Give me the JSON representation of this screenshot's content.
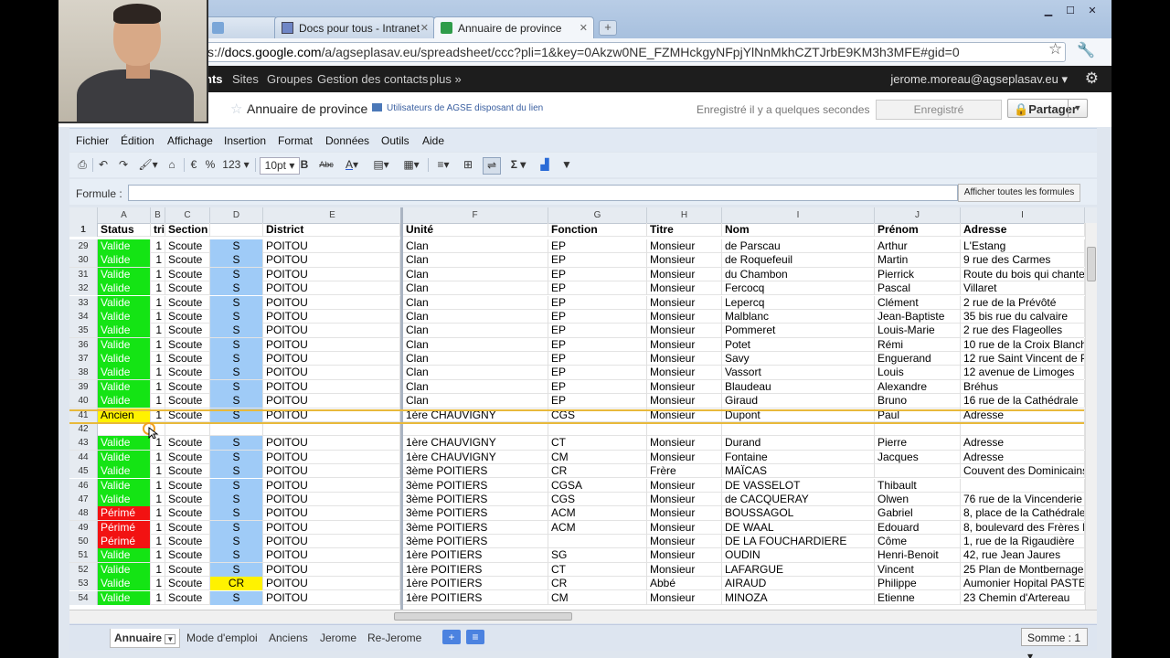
{
  "browser": {
    "tabs": [
      {
        "label": "",
        "active": false
      },
      {
        "label": "Docs pour tous - Intranet",
        "active": false
      },
      {
        "label": "Annuaire de province",
        "active": true
      }
    ],
    "url_prefix": "s://",
    "url_domain": "docs.google.com",
    "url_rest": "/a/agseplasav.eu/spreadsheet/ccc?pli=1&key=0Akzw0NE_FZMHckgyNFpjYlNnMkhCZTJrbE9KM3h3MFE#gid=0"
  },
  "gbar": {
    "links": [
      "nts",
      "Sites",
      "Groupes",
      "Gestion des contacts",
      "plus »"
    ],
    "user": "jerome.moreau@agseplasav.eu ▾"
  },
  "doc": {
    "brand": "nts",
    "title": "Annuaire de province",
    "share_info": "Utilisateurs de AGSE disposant du lien",
    "saved_status": "Enregistré il y a quelques secondes",
    "save_button": "Enregistré",
    "share_button": "Partager"
  },
  "menus": [
    "Fichier",
    "Édition",
    "Affichage",
    "Insertion",
    "Format",
    "Données",
    "Outils",
    "Aide"
  ],
  "toolbar": {
    "euro": "€",
    "percent": "%",
    "numfmt": "123 ▾",
    "fontsize": "10pt ▾",
    "bold": "B",
    "strike": "Abc",
    "sigma": "Σ ▾"
  },
  "formula": {
    "label": "Formule :",
    "value": "",
    "show_all": "Afficher toutes les formules"
  },
  "columns": [
    "A",
    "B",
    "C",
    "D",
    "E",
    "F",
    "G",
    "H",
    "I",
    "J",
    "I"
  ],
  "header_row": {
    "n": "1",
    "cells": [
      "Status",
      "tri",
      "Section",
      "",
      "District",
      "Unité",
      "Fonction",
      "Titre",
      "Nom",
      "Prénom",
      "Adresse"
    ]
  },
  "rows": [
    {
      "n": "29",
      "s": "Valide",
      "sc": "g",
      "t": "1",
      "sec": "Scoute",
      "d": "S",
      "dc": "b",
      "dist": "POITOU",
      "u": "Clan",
      "f": "EP",
      "ti": "Monsieur",
      "nom": "de Parscau",
      "pre": "Arthur",
      "adr": "L'Estang"
    },
    {
      "n": "30",
      "s": "Valide",
      "sc": "g",
      "t": "1",
      "sec": "Scoute",
      "d": "S",
      "dc": "b",
      "dist": "POITOU",
      "u": "Clan",
      "f": "EP",
      "ti": "Monsieur",
      "nom": "de Roquefeuil",
      "pre": "Martin",
      "adr": "9 rue des Carmes"
    },
    {
      "n": "31",
      "s": "Valide",
      "sc": "g",
      "t": "1",
      "sec": "Scoute",
      "d": "S",
      "dc": "b",
      "dist": "POITOU",
      "u": "Clan",
      "f": "EP",
      "ti": "Monsieur",
      "nom": "du Chambon",
      "pre": "Pierrick",
      "adr": "Route du bois qui chante"
    },
    {
      "n": "32",
      "s": "Valide",
      "sc": "g",
      "t": "1",
      "sec": "Scoute",
      "d": "S",
      "dc": "b",
      "dist": "POITOU",
      "u": "Clan",
      "f": "EP",
      "ti": "Monsieur",
      "nom": "Fercocq",
      "pre": "Pascal",
      "adr": "Villaret"
    },
    {
      "n": "33",
      "s": "Valide",
      "sc": "g",
      "t": "1",
      "sec": "Scoute",
      "d": "S",
      "dc": "b",
      "dist": "POITOU",
      "u": "Clan",
      "f": "EP",
      "ti": "Monsieur",
      "nom": "Lepercq",
      "pre": "Clément",
      "adr": "2 rue de la Prévôté"
    },
    {
      "n": "34",
      "s": "Valide",
      "sc": "g",
      "t": "1",
      "sec": "Scoute",
      "d": "S",
      "dc": "b",
      "dist": "POITOU",
      "u": "Clan",
      "f": "EP",
      "ti": "Monsieur",
      "nom": "Malblanc",
      "pre": "Jean-Baptiste",
      "adr": "35 bis rue du calvaire"
    },
    {
      "n": "35",
      "s": "Valide",
      "sc": "g",
      "t": "1",
      "sec": "Scoute",
      "d": "S",
      "dc": "b",
      "dist": "POITOU",
      "u": "Clan",
      "f": "EP",
      "ti": "Monsieur",
      "nom": "Pommeret",
      "pre": "Louis-Marie",
      "adr": "2 rue des Flageolles"
    },
    {
      "n": "36",
      "s": "Valide",
      "sc": "g",
      "t": "1",
      "sec": "Scoute",
      "d": "S",
      "dc": "b",
      "dist": "POITOU",
      "u": "Clan",
      "f": "EP",
      "ti": "Monsieur",
      "nom": "Potet",
      "pre": "Rémi",
      "adr": "10 rue de la Croix Blanch"
    },
    {
      "n": "37",
      "s": "Valide",
      "sc": "g",
      "t": "1",
      "sec": "Scoute",
      "d": "S",
      "dc": "b",
      "dist": "POITOU",
      "u": "Clan",
      "f": "EP",
      "ti": "Monsieur",
      "nom": "Savy",
      "pre": "Enguerand",
      "adr": "12 rue Saint Vincent de P"
    },
    {
      "n": "38",
      "s": "Valide",
      "sc": "g",
      "t": "1",
      "sec": "Scoute",
      "d": "S",
      "dc": "b",
      "dist": "POITOU",
      "u": "Clan",
      "f": "EP",
      "ti": "Monsieur",
      "nom": "Vassort",
      "pre": "Louis",
      "adr": "12 avenue de Limoges"
    },
    {
      "n": "39",
      "s": "Valide",
      "sc": "g",
      "t": "1",
      "sec": "Scoute",
      "d": "S",
      "dc": "b",
      "dist": "POITOU",
      "u": "Clan",
      "f": "EP",
      "ti": "Monsieur",
      "nom": "Blaudeau",
      "pre": "Alexandre",
      "adr": "Bréhus"
    },
    {
      "n": "40",
      "s": "Valide",
      "sc": "g",
      "t": "1",
      "sec": "Scoute",
      "d": "S",
      "dc": "b",
      "dist": "POITOU",
      "u": "Clan",
      "f": "EP",
      "ti": "Monsieur",
      "nom": "Giraud",
      "pre": "Bruno",
      "adr": "16 rue de la Cathédrale"
    },
    {
      "n": "41",
      "s": "Ancien",
      "sc": "y",
      "t": "1",
      "sec": "Scoute",
      "d": "S",
      "dc": "b",
      "dist": "POITOU",
      "u": "1ère CHAUVIGNY",
      "f": "CGS",
      "ti": "Monsieur",
      "nom": "Dupont",
      "pre": "Paul",
      "adr": "Adresse"
    },
    {
      "n": "42",
      "s": "",
      "sc": "",
      "t": "",
      "sec": "",
      "d": "",
      "dc": "",
      "dist": "",
      "u": "",
      "f": "",
      "ti": "",
      "nom": "",
      "pre": "",
      "adr": ""
    },
    {
      "n": "43",
      "s": "Valide",
      "sc": "g",
      "t": "1",
      "sec": "Scoute",
      "d": "S",
      "dc": "b",
      "dist": "POITOU",
      "u": "1ère CHAUVIGNY",
      "f": "CT",
      "ti": "Monsieur",
      "nom": "Durand",
      "pre": "Pierre",
      "adr": "Adresse"
    },
    {
      "n": "44",
      "s": "Valide",
      "sc": "g",
      "t": "1",
      "sec": "Scoute",
      "d": "S",
      "dc": "b",
      "dist": "POITOU",
      "u": "1ère CHAUVIGNY",
      "f": "CM",
      "ti": "Monsieur",
      "nom": "Fontaine",
      "pre": "Jacques",
      "adr": "Adresse"
    },
    {
      "n": "45",
      "s": "Valide",
      "sc": "g",
      "t": "1",
      "sec": "Scoute",
      "d": "S",
      "dc": "b",
      "dist": "POITOU",
      "u": "3ème POITIERS",
      "f": "CR",
      "ti": "Frère",
      "nom": "MAÏCAS",
      "pre": "",
      "adr": "Couvent des Dominicains"
    },
    {
      "n": "46",
      "s": "Valide",
      "sc": "g",
      "t": "1",
      "sec": "Scoute",
      "d": "S",
      "dc": "b",
      "dist": "POITOU",
      "u": "3ème POITIERS",
      "f": "CGSA",
      "ti": "Monsieur",
      "nom": "DE VASSELOT",
      "pre": "Thibault",
      "adr": ""
    },
    {
      "n": "47",
      "s": "Valide",
      "sc": "g",
      "t": "1",
      "sec": "Scoute",
      "d": "S",
      "dc": "b",
      "dist": "POITOU",
      "u": "3ème POITIERS",
      "f": "CGS",
      "ti": "Monsieur",
      "nom": "de CACQUERAY",
      "pre": "Olwen",
      "adr": "76 rue de la Vincenderie"
    },
    {
      "n": "48",
      "s": "Périmé",
      "sc": "r",
      "t": "1",
      "sec": "Scoute",
      "d": "S",
      "dc": "b",
      "dist": "POITOU",
      "u": "3ème POITIERS",
      "f": "ACM",
      "ti": "Monsieur",
      "nom": "BOUSSAGOL",
      "pre": "Gabriel",
      "adr": "8, place de la Cathédrale"
    },
    {
      "n": "49",
      "s": "Périmé",
      "sc": "r",
      "t": "1",
      "sec": "Scoute",
      "d": "S",
      "dc": "b",
      "dist": "POITOU",
      "u": "3ème POITIERS",
      "f": "ACM",
      "ti": "Monsieur",
      "nom": "DE WAAL",
      "pre": "Edouard",
      "adr": "8, boulevard des Frères L"
    },
    {
      "n": "50",
      "s": "Périmé",
      "sc": "r",
      "t": "1",
      "sec": "Scoute",
      "d": "S",
      "dc": "b",
      "dist": "POITOU",
      "u": "3ème POITIERS",
      "f": "",
      "ti": "Monsieur",
      "nom": "DE LA FOUCHARDIERE",
      "pre": "Côme",
      "adr": "1, rue de la Rigaudière"
    },
    {
      "n": "51",
      "s": "Valide",
      "sc": "g",
      "t": "1",
      "sec": "Scoute",
      "d": "S",
      "dc": "b",
      "dist": "POITOU",
      "u": "1ère POITIERS",
      "f": "SG",
      "ti": "Monsieur",
      "nom": "OUDIN",
      "pre": "Henri-Benoit",
      "adr": "42, rue Jean Jaures"
    },
    {
      "n": "52",
      "s": "Valide",
      "sc": "g",
      "t": "1",
      "sec": "Scoute",
      "d": "S",
      "dc": "b",
      "dist": "POITOU",
      "u": "1ère POITIERS",
      "f": "CT",
      "ti": "Monsieur",
      "nom": "LAFARGUE",
      "pre": "Vincent",
      "adr": "25 Plan de Montbernage"
    },
    {
      "n": "53",
      "s": "Valide",
      "sc": "g",
      "t": "1",
      "sec": "Scoute",
      "d": "CR",
      "dc": "cry",
      "dist": "POITOU",
      "u": "1ère POITIERS",
      "f": "CR",
      "ti": "Abbé",
      "nom": "AIRAUD",
      "pre": "Philippe",
      "adr": "Aumonier Hopital PASTE"
    },
    {
      "n": "54",
      "s": "Valide",
      "sc": "g",
      "t": "1",
      "sec": "Scoute",
      "d": "S",
      "dc": "b",
      "dist": "POITOU",
      "u": "1ère POITIERS",
      "f": "CM",
      "ti": "Monsieur",
      "nom": "MINOZA",
      "pre": "Etienne",
      "adr": "23 Chemin d'Artereau"
    }
  ],
  "sheets": [
    "Annuaire",
    "Mode d'emploi",
    "Anciens",
    "Jerome",
    "Re-Jerome"
  ],
  "status": {
    "sum": "Somme : 1 ▾"
  },
  "colors": {
    "valide": "#14e414",
    "perime": "#f21212",
    "ancien": "#fff200",
    "scout_blue": "#9fcbf7"
  }
}
